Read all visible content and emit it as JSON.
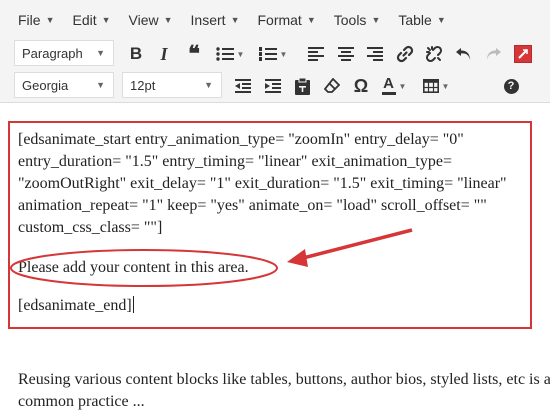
{
  "menubar": {
    "items": [
      {
        "label": "File"
      },
      {
        "label": "Edit"
      },
      {
        "label": "View"
      },
      {
        "label": "Insert"
      },
      {
        "label": "Format"
      },
      {
        "label": "Tools"
      },
      {
        "label": "Table"
      }
    ]
  },
  "toolbar": {
    "format_select": "Paragraph",
    "font_family_select": "Georgia",
    "font_size_select": "12pt",
    "accent_color": "#d63638",
    "icons_row1": [
      "bold-icon",
      "italic-icon",
      "blockquote-icon",
      "bullet-list-icon",
      "numbered-list-icon",
      "align-left-icon",
      "align-center-icon",
      "align-right-icon",
      "link-icon",
      "unlink-icon",
      "undo-icon",
      "redo-icon",
      "fullscreen-icon"
    ],
    "icons_row2": [
      "outdent-icon",
      "indent-icon",
      "paste-as-text-icon",
      "clear-formatting-icon",
      "special-character-icon",
      "text-color-icon",
      "table-icon",
      "help-icon"
    ],
    "labels": {
      "bold": "B",
      "italic": "I",
      "quote": "❝",
      "omega": "Ω",
      "text_color": "A",
      "help": "?"
    }
  },
  "editor": {
    "shortcode_start": "[edsanimate_start entry_animation_type= \"zoomIn\" entry_delay= \"0\" entry_duration= \"1.5\" entry_timing= \"linear\" exit_animation_type= \"zoomOutRight\" exit_delay= \"1\" exit_duration= \"1.5\" exit_timing= \"linear\" animation_repeat= \"1\" keep= \"yes\" animate_on= \"load\" scroll_offset= \"\" custom_css_class= \"\"]",
    "placeholder_content": "Please add your content in this area.",
    "shortcode_end": "[edsanimate_end]",
    "reuse_paragraph": "Reusing various content blocks like tables, buttons, author bios, styled lists, etc is a common practice ...",
    "annotation_color": "#d63638"
  }
}
